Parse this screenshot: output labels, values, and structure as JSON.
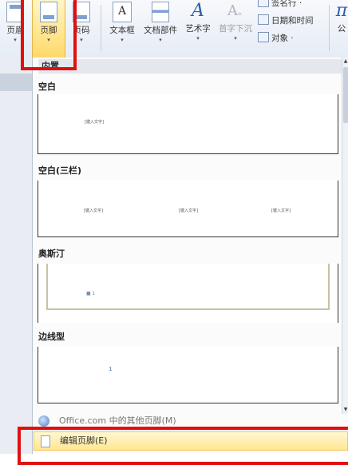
{
  "ribbon": {
    "buttons": [
      {
        "label": "页眉",
        "name": "header"
      },
      {
        "label": "页脚",
        "name": "footer"
      },
      {
        "label": "页码",
        "name": "page-number"
      },
      {
        "label": "文本框",
        "name": "text-box"
      },
      {
        "label": "文档部件",
        "name": "quick-parts"
      },
      {
        "label": "艺术字",
        "name": "wordart"
      },
      {
        "label": "首字下沉",
        "name": "drop-cap"
      }
    ],
    "small_items": [
      "签名行 ·",
      "日期和时间",
      "对象 ·"
    ],
    "partial_label": "公",
    "dropdown_arrow": "▾"
  },
  "panel": {
    "section_header": "内置",
    "templates": [
      {
        "name": "空白",
        "placeholders": [
          "[键入文字]"
        ]
      },
      {
        "name": "空白(三栏)",
        "placeholders": [
          "[键入文字]",
          "[键入文字]",
          "[键入文字]"
        ]
      },
      {
        "name": "奥斯汀",
        "placeholders": [
          "■ 1"
        ]
      },
      {
        "name": "边线型",
        "placeholders": [
          "1"
        ]
      }
    ],
    "menu_items": {
      "office": "Office.com 中的其他页脚(M)",
      "edit": "编辑页脚(E)"
    }
  },
  "colors": {
    "highlight_box": "#e01010",
    "active_button": "#ffd96a",
    "menu_hover": "#ffe690"
  }
}
